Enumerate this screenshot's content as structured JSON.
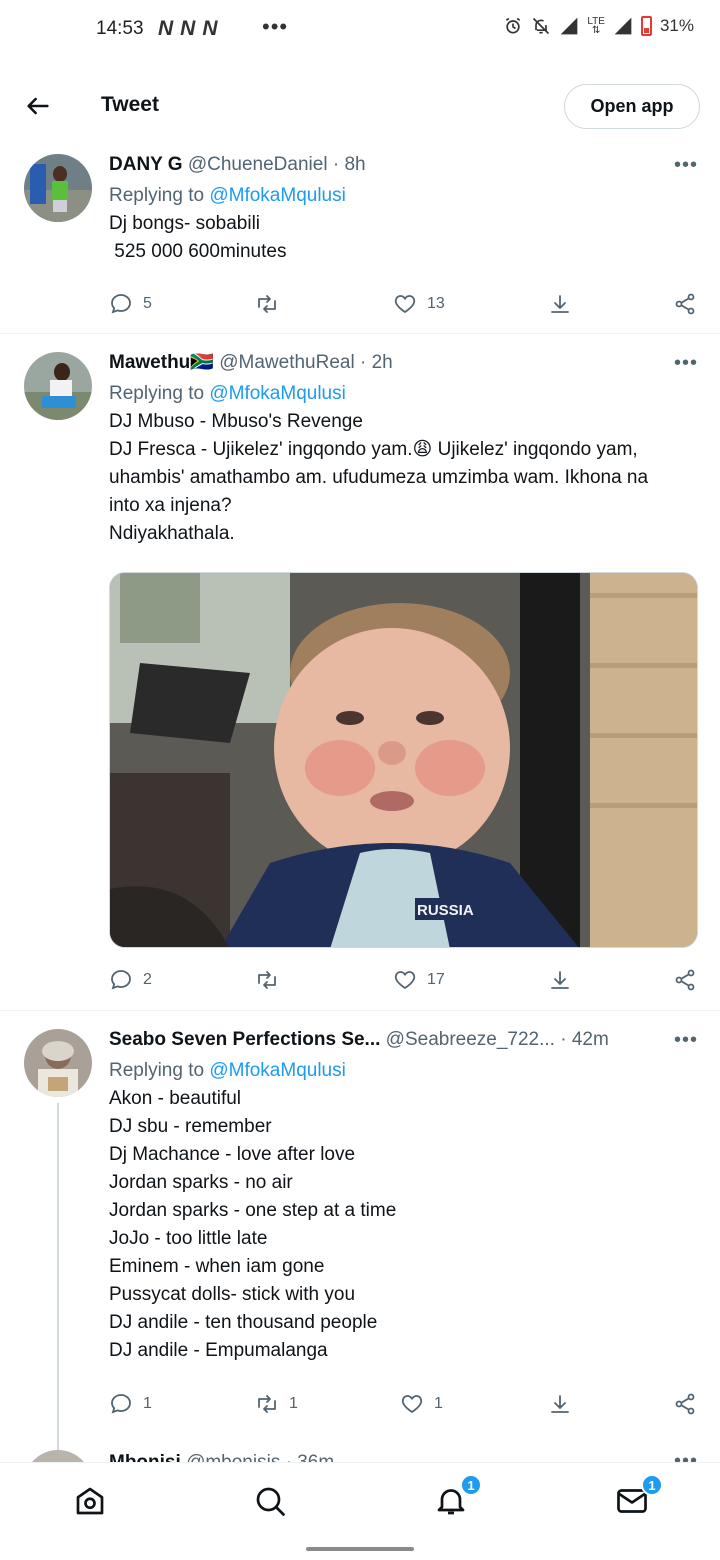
{
  "status_bar": {
    "time": "14:53",
    "network_logos": [
      "N",
      "N",
      "N"
    ],
    "more": "•••",
    "lte": "LTE",
    "battery": "31%"
  },
  "header": {
    "title": "Tweet",
    "open_app": "Open app"
  },
  "tweets": [
    {
      "name": "DANY G",
      "handle": "@ChueneDaniel",
      "time": "· 8h",
      "replying_prefix": "Replying to ",
      "replying_to": "@MfokaMqulusi",
      "lines": [
        "Dj bongs- sobabili",
        " 525 000 600minutes"
      ],
      "replies": "5",
      "retweets": "",
      "likes": "13"
    },
    {
      "name": "Mawethu",
      "flag": "🇿🇦",
      "handle": "@MawethuReal",
      "time": "· 2h",
      "replying_prefix": "Replying to ",
      "replying_to": "@MfokaMqulusi",
      "lines": [
        "DJ Mbuso - Mbuso's Revenge",
        "DJ Fresca - Ujikelez' ingqondo yam.😩 Ujikelez' ingqondo yam,",
        "uhambis' amathambo am. ufudumeza umzimba wam. Ikhona na",
        "into xa injena?",
        "Ndiyakhathala."
      ],
      "media_text": "RUSSIA",
      "replies": "2",
      "retweets": "",
      "likes": "17"
    },
    {
      "name": "Seabo Seven Perfections Se...",
      "handle": "@Seabreeze_722...",
      "time": "· 42m",
      "replying_prefix": "Replying to ",
      "replying_to": "@MfokaMqulusi",
      "lines": [
        "Akon - beautiful",
        "DJ sbu - remember",
        "Dj Machance - love after love",
        "Jordan sparks - no air",
        "Jordan sparks - one step at a time",
        "JoJo - too little late",
        "Eminem - when iam gone",
        "Pussycat dolls- stick with you",
        "DJ andile - ten thousand people",
        "DJ andile - Empumalanga"
      ],
      "replies": "1",
      "retweets": "1",
      "likes": "1"
    },
    {
      "name": "Mbonisi",
      "handle": "@mbonisis",
      "time": "· 36m"
    }
  ],
  "bottom_nav": {
    "notifications_badge": "1",
    "messages_badge": "1"
  }
}
